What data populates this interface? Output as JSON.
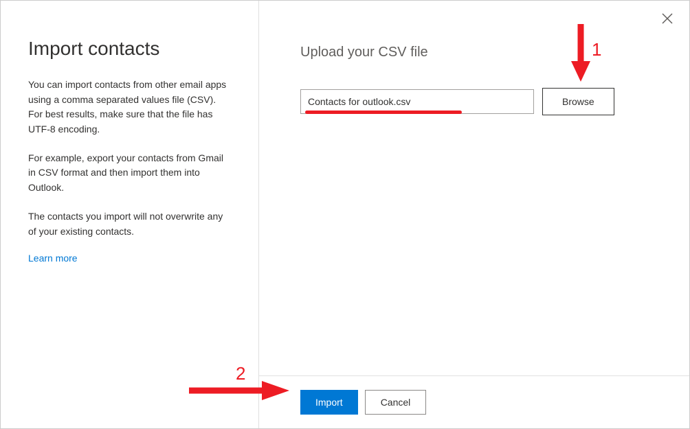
{
  "left": {
    "title": "Import contacts",
    "p1": "You can import contacts from other email apps using a comma separated values file (CSV). For best results, make sure that the file has UTF-8 encoding.",
    "p2": "For example, export your contacts from Gmail in CSV format and then import them into Outlook.",
    "p3": "The contacts you import will not overwrite any of your existing contacts.",
    "learn_more": "Learn more"
  },
  "right": {
    "upload_title": "Upload your CSV file",
    "file_value": "Contacts for outlook.csv",
    "browse_label": "Browse"
  },
  "footer": {
    "import_label": "Import",
    "cancel_label": "Cancel"
  },
  "annotations": {
    "label_1": "1",
    "label_2": "2"
  }
}
